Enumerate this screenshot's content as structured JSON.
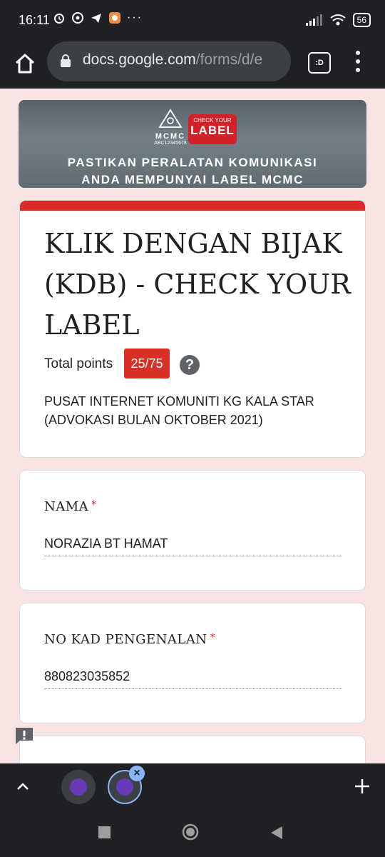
{
  "status_bar": {
    "time": "16:11",
    "battery": "56"
  },
  "browser": {
    "url_main": "docs.google.com",
    "url_path": "/forms/d/e",
    "tab_label": ":D"
  },
  "banner": {
    "brand": "MCMC",
    "code": "ABC12345678",
    "badge_small": "CHECK YOUR",
    "badge_big": "LABEL",
    "line1": "PASTIKAN PERALATAN KOMUNIKASI",
    "line2": "ANDA MEMPUNYAI LABEL MCMC"
  },
  "form": {
    "title": "KLIK DENGAN BIJAK (KDB) - CHECK YOUR LABEL",
    "points_label": "Total points",
    "points_value": "25/75",
    "help_glyph": "?",
    "description": "PUSAT INTERNET KOMUNITI KG KALA STAR (ADVOKASI BULAN OKTOBER 2021)",
    "questions": [
      {
        "label": "NAMA",
        "required": "*",
        "answer": "NORAZIA BT HAMAT"
      },
      {
        "label": "NO KAD PENGENALAN",
        "required": "*",
        "answer": "880823035852"
      }
    ]
  },
  "colors": {
    "accent": "#db2b27",
    "badge": "#d93025",
    "page_bg": "#f9e4e4"
  }
}
